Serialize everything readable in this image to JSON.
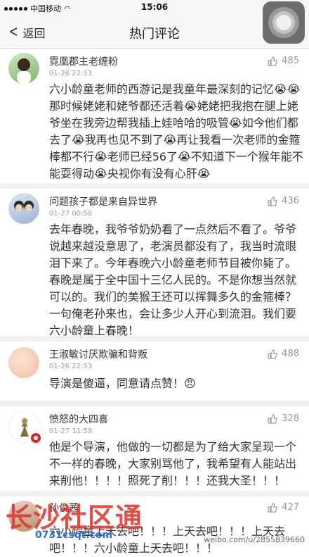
{
  "status": {
    "carrier": "中国移动",
    "time": "15:06"
  },
  "nav": {
    "back_label": "返回",
    "title": "热门评论"
  },
  "comments": [
    {
      "user": "霓凰郡主老缠粉",
      "time": "01-26 22:13",
      "likes": "485",
      "text": "六小龄童老师的西游记是我童年最深刻的记忆😭😭那时候姥姥和姥爷都还活着😭姥姥把我抱在腿上姥爷坐在我旁边帮我插上娃哈哈的吸管😭如今他们都去了😭我再也见不到了😭再让我看一次老师的金箍棒都不行😭老师已经56了😭不知道下一个猴年能不能耍得动😭央视你有没有心肝😭"
    },
    {
      "user": "问题孩子都是来自异世界",
      "time": "01-27 00:58",
      "likes": "436",
      "text": "去年春晚，我爷爷奶奶看了一点然后不看了。爷爷说越来越没意思了，老演员都没有了，我当时流眼泪下来了。今年春晚六小龄童老师节目被你毙了。春晚是属于全中国十三亿人民的。不是你想当然就可以的。我们的美猴王还可以挥舞多久的金箍棒？一句俺老孙来也，会让多少人开心到流泪。我们要六小龄童上春晚！"
    },
    {
      "user": "王淑敏讨厌欺骗和背叛",
      "time": "01-26 22:53",
      "likes": "488",
      "text": "导演是傻逼，同意请点赞！😠"
    },
    {
      "user": "愤怒的大四喜",
      "time": "01-27 11:59",
      "likes": "328",
      "text": "他是个导演，他做的一切都是为了给大家呈现一个不一样的春晚，大家别骂他了，我希望有人能站出来削他！！！！照死了削！！！还我大圣！！！"
    },
    {
      "user": "孙俊茜",
      "time": "",
      "likes": "427",
      "text": "六小龄童上天去吧！！！上天去吧！！！上天去吧！！！六小龄童上天去吧！！！"
    }
  ],
  "watermark": {
    "text": "长沙社区通",
    "url": "0731csqt.com",
    "weibo": "weibo.com/u/2855839660"
  }
}
